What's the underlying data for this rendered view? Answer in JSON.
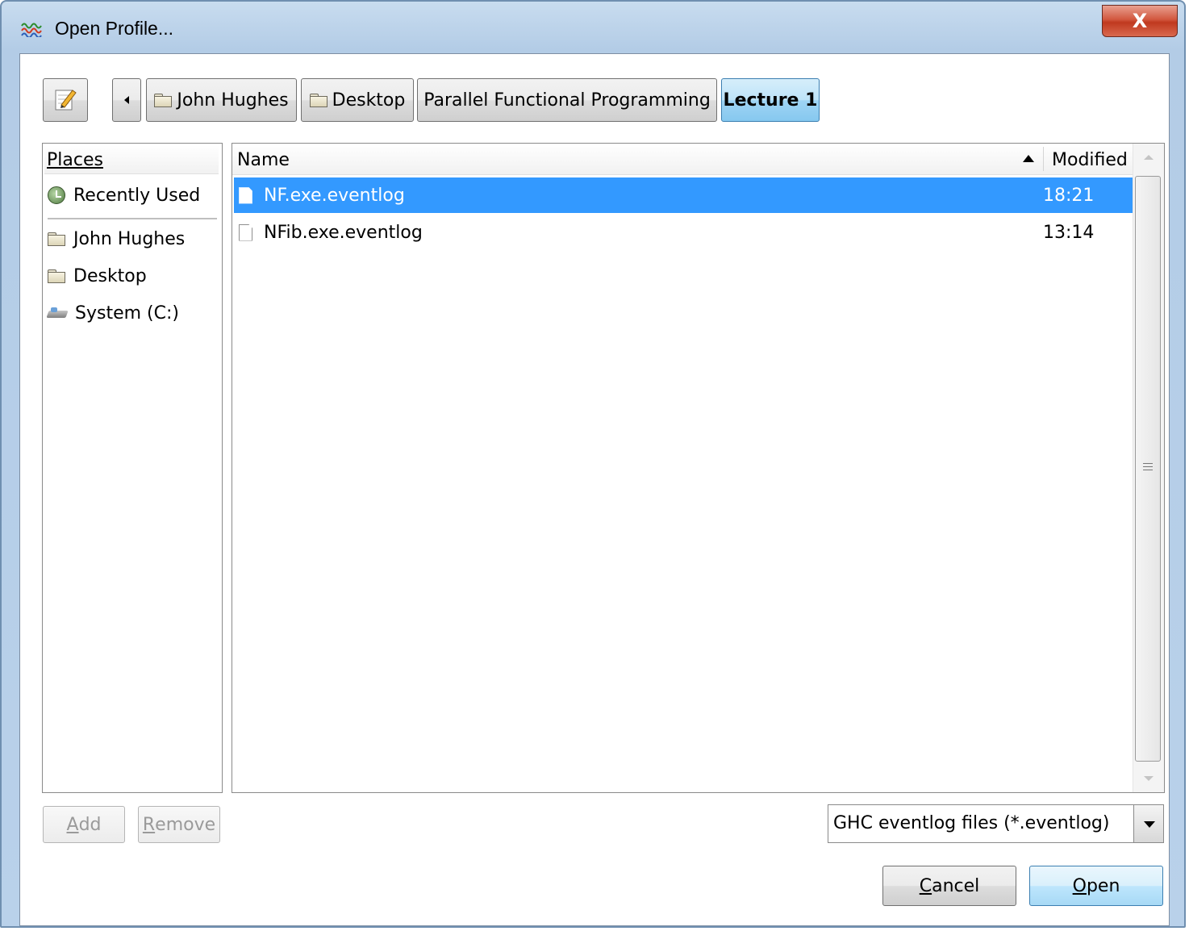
{
  "window": {
    "title": "Open Profile...",
    "close_label": "X"
  },
  "pathbar": {
    "crumbs": [
      {
        "label": "John Hughes",
        "icon": "folder-icon"
      },
      {
        "label": "Desktop",
        "icon": "folder-icon"
      },
      {
        "label": "Parallel Functional Programming"
      },
      {
        "label": "Lecture 1",
        "active": true
      }
    ]
  },
  "places": {
    "header": "Places",
    "items": [
      {
        "label": "Recently Used",
        "icon": "recently-used-icon"
      },
      {
        "label": "John Hughes",
        "icon": "folder-icon"
      },
      {
        "label": "Desktop",
        "icon": "folder-icon"
      },
      {
        "label": "System (C:)",
        "icon": "drive-icon"
      }
    ]
  },
  "files": {
    "columns": {
      "name": "Name",
      "modified": "Modified"
    },
    "rows": [
      {
        "name": "NF.exe.eventlog",
        "modified": "18:21",
        "selected": true
      },
      {
        "name": "NFib.exe.eventlog",
        "modified": "13:14",
        "selected": false
      }
    ]
  },
  "buttons": {
    "add_label_u": "A",
    "add_label_rest": "dd",
    "remove_label_u": "R",
    "remove_label_rest": "emove",
    "cancel_label_u": "C",
    "cancel_label_rest": "ancel",
    "open_label_u": "O",
    "open_label_rest": "pen"
  },
  "filter": {
    "selected": "GHC eventlog files (*.eventlog)"
  },
  "colors": {
    "selection": "#3399ff",
    "close_button": "#c0391f",
    "active_crumb": "#86c8ef"
  }
}
